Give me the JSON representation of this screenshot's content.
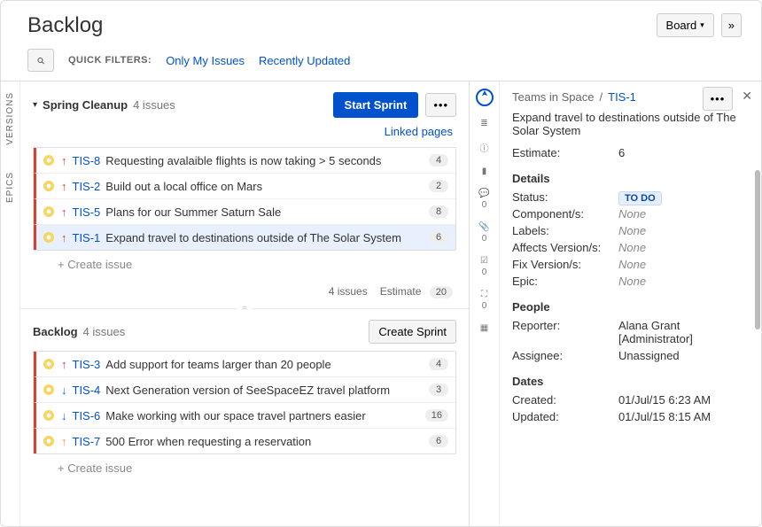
{
  "header": {
    "title": "Backlog",
    "board_button": "Board",
    "collapse_icon": "»"
  },
  "filters": {
    "label": "QUICK FILTERS:",
    "items": [
      "Only My Issues",
      "Recently Updated"
    ]
  },
  "side_tabs": [
    "VERSIONS",
    "EPICS"
  ],
  "sections": [
    {
      "title": "Spring Cleanup",
      "count_text": "4 issues",
      "primary_action": "Start Sprint",
      "linked_pages": "Linked pages",
      "issues": [
        {
          "key": "TIS-8",
          "summary": "Requesting avalaible flights is now taking > 5 seconds",
          "estimate": "4",
          "priority": "up-red"
        },
        {
          "key": "TIS-2",
          "summary": "Build out a local office on Mars",
          "estimate": "2",
          "priority": "up-red"
        },
        {
          "key": "TIS-5",
          "summary": "Plans for our Summer Saturn Sale",
          "estimate": "8",
          "priority": "up-red"
        },
        {
          "key": "TIS-1",
          "summary": "Expand travel to destinations outside of The Solar System",
          "estimate": "6",
          "priority": "up-red",
          "selected": true
        }
      ],
      "create_label": "+  Create issue",
      "footer_count": "4 issues",
      "footer_estimate_label": "Estimate",
      "footer_estimate_value": "20"
    },
    {
      "title": "Backlog",
      "count_text": "4 issues",
      "primary_action": "Create Sprint",
      "issues": [
        {
          "key": "TIS-3",
          "summary": "Add support for teams larger than 20 people",
          "estimate": "4",
          "priority": "up-red"
        },
        {
          "key": "TIS-4",
          "summary": "Next Generation version of SeeSpaceEZ travel platform",
          "estimate": "3",
          "priority": "down"
        },
        {
          "key": "TIS-6",
          "summary": "Make working with our space travel partners easier",
          "estimate": "16",
          "priority": "down"
        },
        {
          "key": "TIS-7",
          "summary": "500 Error when requesting a reservation",
          "estimate": "6",
          "priority": "up-orange"
        }
      ],
      "create_label": "+  Create issue"
    }
  ],
  "detail": {
    "project": "Teams in Space",
    "key": "TIS-1",
    "summary": "Expand travel to destinations outside of The Solar System",
    "estimate_label": "Estimate:",
    "estimate_value": "6",
    "details_head": "Details",
    "fields": {
      "status_label": "Status:",
      "status_value": "TO DO",
      "components_label": "Component/s:",
      "components_value": "None",
      "labels_label": "Labels:",
      "labels_value": "None",
      "affects_label": "Affects Version/s:",
      "affects_value": "None",
      "fix_label": "Fix Version/s:",
      "fix_value": "None",
      "epic_label": "Epic:",
      "epic_value": "None"
    },
    "people_head": "People",
    "reporter_label": "Reporter:",
    "reporter_value": "Alana Grant",
    "reporter_role": "[Administrator]",
    "assignee_label": "Assignee:",
    "assignee_value": "Unassigned",
    "dates_head": "Dates",
    "created_label": "Created:",
    "created_value": "01/Jul/15 6:23 AM",
    "updated_label": "Updated:",
    "updated_value": "01/Jul/15 8:15 AM"
  },
  "nav_counts": [
    "0",
    "0",
    "0",
    "0"
  ]
}
